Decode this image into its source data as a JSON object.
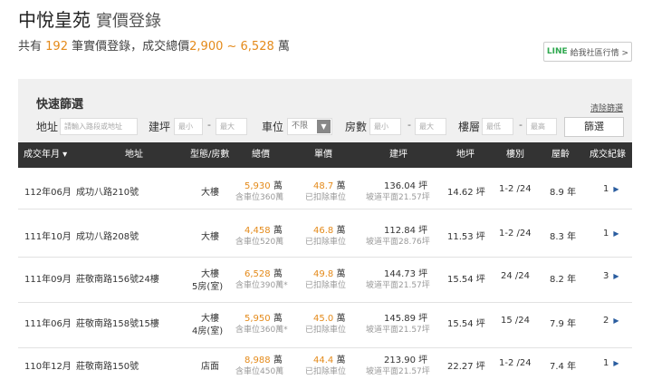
{
  "page_title": "中悅皇苑",
  "page_subtitle": "實價登錄",
  "summary": {
    "prefix": "共有",
    "count": "192",
    "mid": "筆實價登錄，成交總價",
    "range": "2,900 ~ 6,528",
    "suffix": "萬"
  },
  "line_button": {
    "logo": "LINE",
    "label": "給我社區行情 >"
  },
  "filter": {
    "title": "快速篩選",
    "clear_label": "清除篩選",
    "address_label": "地址",
    "address_placeholder": "請輸入路段或地址",
    "area_label": "建坪",
    "area_min": "最小",
    "area_max": "最大",
    "parking_label": "車位",
    "parking_value": "不限",
    "rooms_label": "房數",
    "rooms_min": "最小",
    "rooms_max": "最大",
    "floor_label": "樓層",
    "floor_min": "最低",
    "floor_max": "最高",
    "dash": "-",
    "search_label": "篩選"
  },
  "table": {
    "headers": [
      "成交年月 ▾",
      "地址",
      "型態/房數",
      "總價",
      "單價",
      "建坪",
      "地坪",
      "樓別",
      "屋齡",
      "成交紀錄"
    ],
    "rows": [
      {
        "date": "112年06月",
        "address": "成功八路210號",
        "type": "大樓",
        "rooms": "",
        "price": "5,930",
        "price_unit": "萬",
        "price_note": "含車位360萬",
        "unit_price": "48.7",
        "unit_unit": "萬",
        "unit_note": "已扣除車位",
        "area": "136.04 坪",
        "area_note": "坡道平面21.57坪",
        "land": "14.62 坪",
        "floor": "1-2 /24",
        "age": "8.9 年",
        "records": "1"
      },
      {
        "date": "111年10月",
        "address": "成功八路208號",
        "type": "大樓",
        "rooms": "",
        "price": "4,458",
        "price_unit": "萬",
        "price_note": "含車位520萬",
        "unit_price": "46.8",
        "unit_unit": "萬",
        "unit_note": "已扣除車位",
        "area": "112.84 坪",
        "area_note": "坡道平面28.76坪",
        "land": "11.53 坪",
        "floor": "1-2 /24",
        "age": "8.3 年",
        "records": "1"
      },
      {
        "date": "111年09月",
        "address": "莊敬南路156號24樓",
        "type": "大樓",
        "rooms": "5房(室)",
        "price": "6,528",
        "price_unit": "萬",
        "price_note": "含車位390萬*",
        "unit_price": "49.8",
        "unit_unit": "萬",
        "unit_note": "已扣除車位",
        "area": "144.73 坪",
        "area_note": "坡道平面21.57坪",
        "land": "15.54 坪",
        "floor": "24 /24",
        "age": "8.2 年",
        "records": "3"
      },
      {
        "date": "111年06月",
        "address": "莊敬南路158號15樓",
        "type": "大樓",
        "rooms": "4房(室)",
        "price": "5,950",
        "price_unit": "萬",
        "price_note": "含車位360萬*",
        "unit_price": "45.0",
        "unit_unit": "萬",
        "unit_note": "已扣除車位",
        "area": "145.89 坪",
        "area_note": "坡道平面21.57坪",
        "land": "15.54 坪",
        "floor": "15 /24",
        "age": "7.9 年",
        "records": "2"
      },
      {
        "date": "110年12月",
        "address": "莊敬南路150號",
        "type": "店面",
        "rooms": "",
        "price": "8,988",
        "price_unit": "萬",
        "price_note": "含車位450萬",
        "unit_price": "44.4",
        "unit_unit": "萬",
        "unit_note": "已扣除車位",
        "area": "213.90 坪",
        "area_note": "坡道平面21.57坪",
        "land": "22.27 坪",
        "floor": "1-2 /24",
        "age": "7.4 年",
        "records": "1"
      }
    ]
  },
  "colors": {
    "accent": "#e48a1a",
    "header_bg": "#333333",
    "filter_bg": "#f0f0f0",
    "line_green": "#2fa84f",
    "arrow_blue": "#2a5d9f"
  }
}
